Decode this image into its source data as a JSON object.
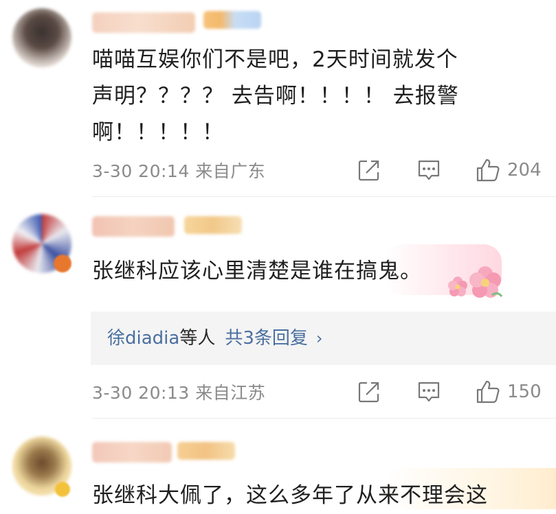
{
  "comments": [
    {
      "text": "喵喵互娱你们不是吧，2天时间就发个\n声明？？？？ 去告啊！！！！ 去报警\n啊！！！！！",
      "time": "3-30 20:14",
      "location": "来自广东",
      "likes": "204"
    },
    {
      "text": "张继科应该心里清楚是谁在搞鬼。",
      "time": "3-30 20:13",
      "location": "来自江苏",
      "likes": "150",
      "replies": {
        "users": "徐diadia",
        "suffix": "等人",
        "count_label": "共3条回复",
        "chevron": "›"
      }
    },
    {
      "text": "张继科大佩了，这么多年了从来不理会这"
    }
  ],
  "icons": {
    "share": "share-icon",
    "comment": "comment-icon",
    "like": "like-icon",
    "sticker": "flower-sticker-icon"
  },
  "colors": {
    "meta_gray": "#8a8a8a",
    "link_blue": "#4a6fa0",
    "reply_bg": "#f4f4f4"
  }
}
